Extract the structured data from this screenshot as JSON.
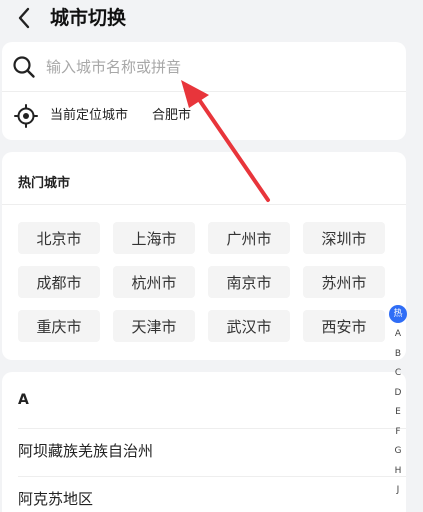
{
  "header": {
    "title": "城市切换",
    "back_icon": "chevron-left-icon"
  },
  "search": {
    "placeholder": "输入城市名称或拼音",
    "value": "",
    "icon": "search-icon"
  },
  "location": {
    "icon": "locate-icon",
    "label": "当前定位城市",
    "city": "合肥市"
  },
  "hot_cities": {
    "title": "热门城市",
    "cities": [
      "北京市",
      "上海市",
      "广州市",
      "深圳市",
      "成都市",
      "杭州市",
      "南京市",
      "苏州市",
      "重庆市",
      "天津市",
      "武汉市",
      "西安市"
    ]
  },
  "city_list": {
    "section_letter": "A",
    "items": [
      "阿坝藏族羌族自治州",
      "阿克苏地区"
    ]
  },
  "index_bar": {
    "active": "热",
    "letters": [
      "A",
      "B",
      "C",
      "D",
      "E",
      "F",
      "G",
      "H",
      "J"
    ]
  },
  "colors": {
    "accent": "#2f6df6",
    "annotation_arrow": "#e8353b"
  }
}
